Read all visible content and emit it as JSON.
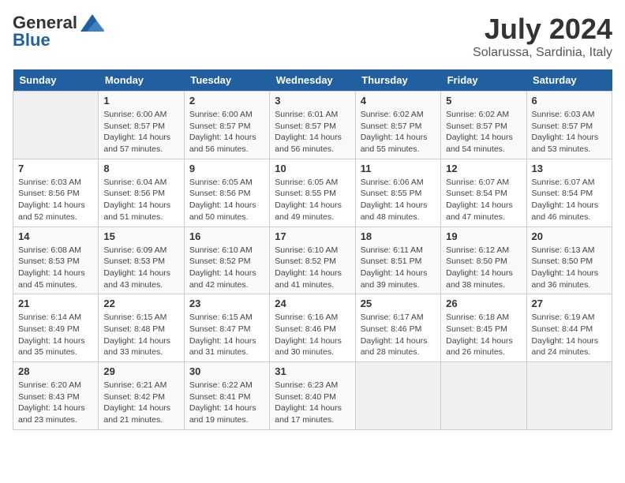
{
  "logo": {
    "general": "General",
    "blue": "Blue"
  },
  "title": "July 2024",
  "subtitle": "Solarussa, Sardinia, Italy",
  "days_of_week": [
    "Sunday",
    "Monday",
    "Tuesday",
    "Wednesday",
    "Thursday",
    "Friday",
    "Saturday"
  ],
  "weeks": [
    [
      {
        "day": "",
        "sunrise": "",
        "sunset": "",
        "daylight": ""
      },
      {
        "day": "1",
        "sunrise": "Sunrise: 6:00 AM",
        "sunset": "Sunset: 8:57 PM",
        "daylight": "Daylight: 14 hours and 57 minutes."
      },
      {
        "day": "2",
        "sunrise": "Sunrise: 6:00 AM",
        "sunset": "Sunset: 8:57 PM",
        "daylight": "Daylight: 14 hours and 56 minutes."
      },
      {
        "day": "3",
        "sunrise": "Sunrise: 6:01 AM",
        "sunset": "Sunset: 8:57 PM",
        "daylight": "Daylight: 14 hours and 56 minutes."
      },
      {
        "day": "4",
        "sunrise": "Sunrise: 6:02 AM",
        "sunset": "Sunset: 8:57 PM",
        "daylight": "Daylight: 14 hours and 55 minutes."
      },
      {
        "day": "5",
        "sunrise": "Sunrise: 6:02 AM",
        "sunset": "Sunset: 8:57 PM",
        "daylight": "Daylight: 14 hours and 54 minutes."
      },
      {
        "day": "6",
        "sunrise": "Sunrise: 6:03 AM",
        "sunset": "Sunset: 8:57 PM",
        "daylight": "Daylight: 14 hours and 53 minutes."
      }
    ],
    [
      {
        "day": "7",
        "sunrise": "Sunrise: 6:03 AM",
        "sunset": "Sunset: 8:56 PM",
        "daylight": "Daylight: 14 hours and 52 minutes."
      },
      {
        "day": "8",
        "sunrise": "Sunrise: 6:04 AM",
        "sunset": "Sunset: 8:56 PM",
        "daylight": "Daylight: 14 hours and 51 minutes."
      },
      {
        "day": "9",
        "sunrise": "Sunrise: 6:05 AM",
        "sunset": "Sunset: 8:56 PM",
        "daylight": "Daylight: 14 hours and 50 minutes."
      },
      {
        "day": "10",
        "sunrise": "Sunrise: 6:05 AM",
        "sunset": "Sunset: 8:55 PM",
        "daylight": "Daylight: 14 hours and 49 minutes."
      },
      {
        "day": "11",
        "sunrise": "Sunrise: 6:06 AM",
        "sunset": "Sunset: 8:55 PM",
        "daylight": "Daylight: 14 hours and 48 minutes."
      },
      {
        "day": "12",
        "sunrise": "Sunrise: 6:07 AM",
        "sunset": "Sunset: 8:54 PM",
        "daylight": "Daylight: 14 hours and 47 minutes."
      },
      {
        "day": "13",
        "sunrise": "Sunrise: 6:07 AM",
        "sunset": "Sunset: 8:54 PM",
        "daylight": "Daylight: 14 hours and 46 minutes."
      }
    ],
    [
      {
        "day": "14",
        "sunrise": "Sunrise: 6:08 AM",
        "sunset": "Sunset: 8:53 PM",
        "daylight": "Daylight: 14 hours and 45 minutes."
      },
      {
        "day": "15",
        "sunrise": "Sunrise: 6:09 AM",
        "sunset": "Sunset: 8:53 PM",
        "daylight": "Daylight: 14 hours and 43 minutes."
      },
      {
        "day": "16",
        "sunrise": "Sunrise: 6:10 AM",
        "sunset": "Sunset: 8:52 PM",
        "daylight": "Daylight: 14 hours and 42 minutes."
      },
      {
        "day": "17",
        "sunrise": "Sunrise: 6:10 AM",
        "sunset": "Sunset: 8:52 PM",
        "daylight": "Daylight: 14 hours and 41 minutes."
      },
      {
        "day": "18",
        "sunrise": "Sunrise: 6:11 AM",
        "sunset": "Sunset: 8:51 PM",
        "daylight": "Daylight: 14 hours and 39 minutes."
      },
      {
        "day": "19",
        "sunrise": "Sunrise: 6:12 AM",
        "sunset": "Sunset: 8:50 PM",
        "daylight": "Daylight: 14 hours and 38 minutes."
      },
      {
        "day": "20",
        "sunrise": "Sunrise: 6:13 AM",
        "sunset": "Sunset: 8:50 PM",
        "daylight": "Daylight: 14 hours and 36 minutes."
      }
    ],
    [
      {
        "day": "21",
        "sunrise": "Sunrise: 6:14 AM",
        "sunset": "Sunset: 8:49 PM",
        "daylight": "Daylight: 14 hours and 35 minutes."
      },
      {
        "day": "22",
        "sunrise": "Sunrise: 6:15 AM",
        "sunset": "Sunset: 8:48 PM",
        "daylight": "Daylight: 14 hours and 33 minutes."
      },
      {
        "day": "23",
        "sunrise": "Sunrise: 6:15 AM",
        "sunset": "Sunset: 8:47 PM",
        "daylight": "Daylight: 14 hours and 31 minutes."
      },
      {
        "day": "24",
        "sunrise": "Sunrise: 6:16 AM",
        "sunset": "Sunset: 8:46 PM",
        "daylight": "Daylight: 14 hours and 30 minutes."
      },
      {
        "day": "25",
        "sunrise": "Sunrise: 6:17 AM",
        "sunset": "Sunset: 8:46 PM",
        "daylight": "Daylight: 14 hours and 28 minutes."
      },
      {
        "day": "26",
        "sunrise": "Sunrise: 6:18 AM",
        "sunset": "Sunset: 8:45 PM",
        "daylight": "Daylight: 14 hours and 26 minutes."
      },
      {
        "day": "27",
        "sunrise": "Sunrise: 6:19 AM",
        "sunset": "Sunset: 8:44 PM",
        "daylight": "Daylight: 14 hours and 24 minutes."
      }
    ],
    [
      {
        "day": "28",
        "sunrise": "Sunrise: 6:20 AM",
        "sunset": "Sunset: 8:43 PM",
        "daylight": "Daylight: 14 hours and 23 minutes."
      },
      {
        "day": "29",
        "sunrise": "Sunrise: 6:21 AM",
        "sunset": "Sunset: 8:42 PM",
        "daylight": "Daylight: 14 hours and 21 minutes."
      },
      {
        "day": "30",
        "sunrise": "Sunrise: 6:22 AM",
        "sunset": "Sunset: 8:41 PM",
        "daylight": "Daylight: 14 hours and 19 minutes."
      },
      {
        "day": "31",
        "sunrise": "Sunrise: 6:23 AM",
        "sunset": "Sunset: 8:40 PM",
        "daylight": "Daylight: 14 hours and 17 minutes."
      },
      {
        "day": "",
        "sunrise": "",
        "sunset": "",
        "daylight": ""
      },
      {
        "day": "",
        "sunrise": "",
        "sunset": "",
        "daylight": ""
      },
      {
        "day": "",
        "sunrise": "",
        "sunset": "",
        "daylight": ""
      }
    ]
  ]
}
